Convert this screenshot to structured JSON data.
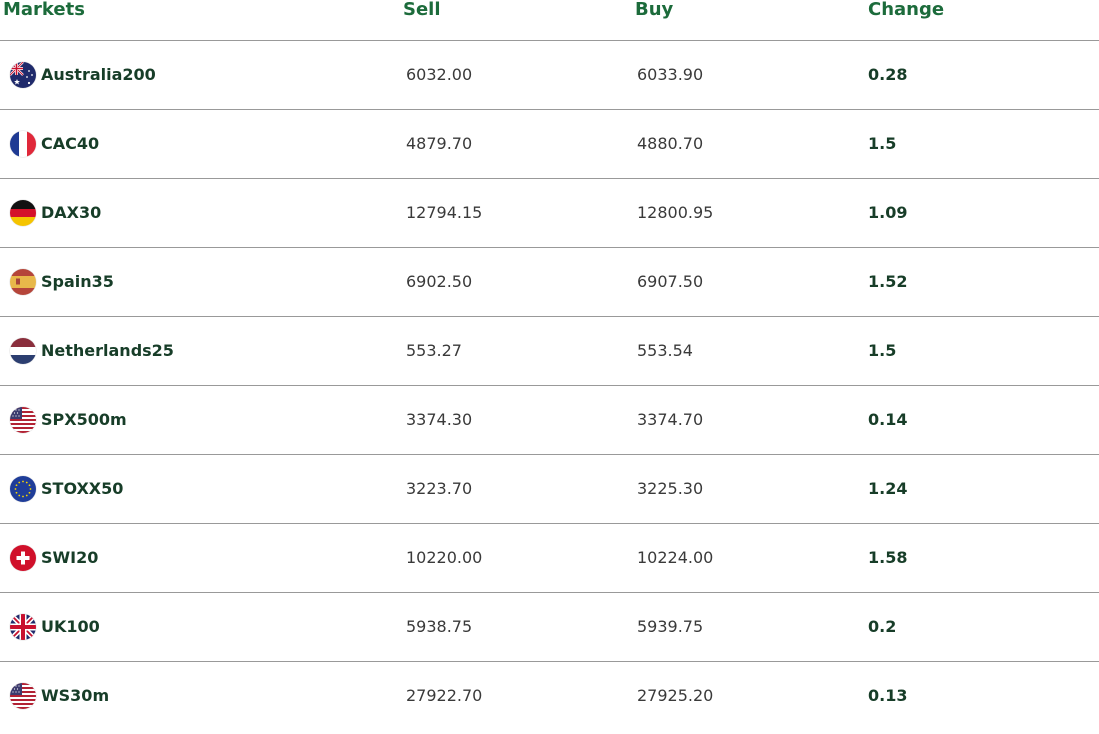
{
  "header": {
    "markets": "Markets",
    "sell": "Sell",
    "buy": "Buy",
    "change": "Change"
  },
  "rows": [
    {
      "market": "Australia200",
      "flag_icon": "australia-flag-icon",
      "sell": "6032.00",
      "buy": "6033.90",
      "change": "0.28"
    },
    {
      "market": "CAC40",
      "flag_icon": "france-flag-icon",
      "sell": "4879.70",
      "buy": "4880.70",
      "change": "1.5"
    },
    {
      "market": "DAX30",
      "flag_icon": "germany-flag-icon",
      "sell": "12794.15",
      "buy": "12800.95",
      "change": "1.09"
    },
    {
      "market": "Spain35",
      "flag_icon": "spain-flag-icon",
      "sell": "6902.50",
      "buy": "6907.50",
      "change": "1.52"
    },
    {
      "market": "Netherlands25",
      "flag_icon": "netherlands-flag-icon",
      "sell": "553.27",
      "buy": "553.54",
      "change": "1.5"
    },
    {
      "market": "SPX500m",
      "flag_icon": "usa-flag-icon",
      "sell": "3374.30",
      "buy": "3374.70",
      "change": "0.14"
    },
    {
      "market": "STOXX50",
      "flag_icon": "eu-flag-icon",
      "sell": "3223.70",
      "buy": "3225.30",
      "change": "1.24"
    },
    {
      "market": "SWI20",
      "flag_icon": "switzerland-flag-icon",
      "sell": "10220.00",
      "buy": "10224.00",
      "change": "1.58"
    },
    {
      "market": "UK100",
      "flag_icon": "uk-flag-icon",
      "sell": "5938.75",
      "buy": "5939.75",
      "change": "0.2"
    },
    {
      "market": "WS30m",
      "flag_icon": "usa-flag-icon",
      "sell": "27922.70",
      "buy": "27925.20",
      "change": "0.13"
    }
  ],
  "colors": {
    "header_text": "#1c6b3b",
    "market_text": "#173d28",
    "value_text": "#3a3a3a",
    "divider": "#999999"
  }
}
